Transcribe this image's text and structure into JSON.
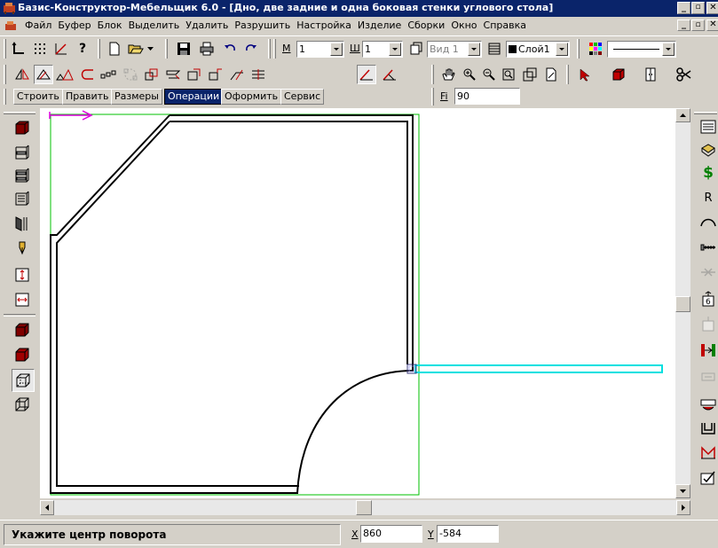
{
  "window": {
    "title": "Базис-Конструктор-Мебельщик 6.0 - [Дно,  две задние и одна боковая стенки углового стола]"
  },
  "menu": [
    "Файл",
    "Буфер",
    "Блок",
    "Выделить",
    "Удалить",
    "Разрушить",
    "Настройка",
    "Изделие",
    "Сборки",
    "Окно",
    "Справка"
  ],
  "toolbar": {
    "m_label": "М",
    "m_value": "1",
    "sh_label": "Ш",
    "sh_value": "1",
    "view_value": "Вид 1",
    "layer_value": "Слой1"
  },
  "tabs": [
    {
      "label": "Строить",
      "active": false
    },
    {
      "label": "Править",
      "active": false
    },
    {
      "label": "Размеры",
      "active": false
    },
    {
      "label": "Операции",
      "active": true
    },
    {
      "label": "Оформить",
      "active": false
    },
    {
      "label": "Сервис",
      "active": false
    }
  ],
  "angle": {
    "label": "Fi",
    "value": "90"
  },
  "status": {
    "prompt": "Укажите центр поворота",
    "x_label": "X",
    "x_value": "860",
    "y_label": "Y",
    "y_value": "-584"
  },
  "colors": {
    "title_bar": "#0a246a",
    "outline": "#000000",
    "bbox": "#00c000",
    "highlight": "#00e0e0",
    "axis": "#e000e0",
    "active_tab": "#0a246a"
  },
  "icons": {
    "right_toolbar_text": "R",
    "right_toolbar_price": "$"
  }
}
